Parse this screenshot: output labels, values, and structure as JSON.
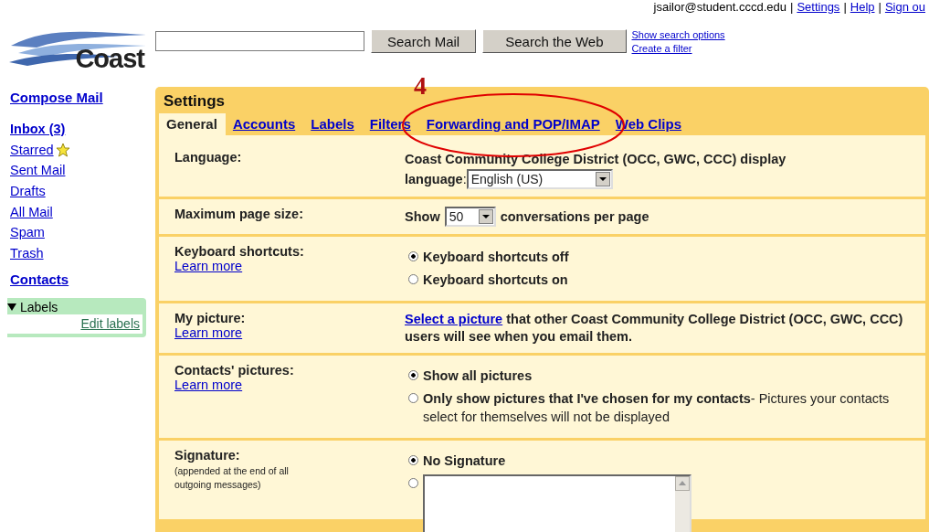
{
  "account": {
    "email": "jsailor@student.cccd.edu",
    "links": [
      {
        "separator": "|",
        "label": "Settings"
      },
      {
        "separator": "|",
        "label": "Help"
      },
      {
        "separator": "|",
        "label": "Sign ou"
      }
    ]
  },
  "logo": {
    "text": "Coast"
  },
  "search": {
    "buttons": [
      "Search Mail",
      "Search the Web"
    ],
    "links": [
      "Show search options",
      "Create a filter"
    ]
  },
  "sidebar": {
    "compose": "Compose Mail",
    "folders": [
      {
        "label": "Inbox (3)",
        "bold": true,
        "starred": false
      },
      {
        "label": "Starred",
        "bold": false,
        "starred": true
      },
      {
        "label": "Sent Mail",
        "bold": false,
        "starred": false
      },
      {
        "label": "Drafts",
        "bold": false,
        "starred": false
      },
      {
        "label": "All Mail",
        "bold": false,
        "starred": false
      },
      {
        "label": "Spam",
        "bold": false,
        "starred": false
      },
      {
        "label": "Trash",
        "bold": false,
        "starred": false
      }
    ],
    "contacts": "Contacts",
    "labels": {
      "title": "Labels",
      "expanded": true,
      "edit": "Edit labels"
    }
  },
  "settings": {
    "title": "Settings",
    "annotation": {
      "number": "4"
    },
    "tabs": [
      {
        "label": "General",
        "selected": true
      },
      {
        "label": "Accounts",
        "selected": false
      },
      {
        "label": "Labels",
        "selected": false
      },
      {
        "label": "Filters",
        "selected": false
      },
      {
        "label": "Forwarding and POP/IMAP",
        "selected": false
      },
      {
        "label": "Web Clips",
        "selected": false
      }
    ],
    "rows": [
      {
        "kind": "language",
        "label": "Language:",
        "text": "Coast Community College District (OCC, GWC, CCC) display",
        "field_label": "**language**:",
        "value": "English (US)"
      },
      {
        "kind": "pagesize",
        "label": "Maximum page size:",
        "before": "Show",
        "value": "50",
        "after": "conversations per page"
      },
      {
        "kind": "radio",
        "label": "Keyboard shortcuts:",
        "learn_more": "Learn more",
        "options": [
          {
            "label": "Keyboard shortcuts off",
            "selected": true
          },
          {
            "label": "Keyboard shortcuts on",
            "selected": false
          }
        ]
      },
      {
        "kind": "picture",
        "label": "My picture:",
        "learn_more": "Learn more",
        "link": "Select a picture",
        "text": " that other Coast Community College District (OCC, GWC, CCC) users will see when you email them."
      },
      {
        "kind": "radio",
        "label": "Contacts' pictures:",
        "learn_more": "Learn more",
        "options": [
          {
            "label": "Show all pictures",
            "selected": true
          },
          {
            "label": "Only show pictures that I've chosen for my contacts",
            "note": "- Pictures your contacts select for themselves will not be displayed",
            "selected": false
          }
        ]
      },
      {
        "kind": "signature",
        "label": "Signature:",
        "note": "(appended at the end of all outgoing messages)",
        "options": [
          {
            "label": "No Signature",
            "selected": true
          },
          {
            "selected": false
          }
        ]
      }
    ]
  }
}
